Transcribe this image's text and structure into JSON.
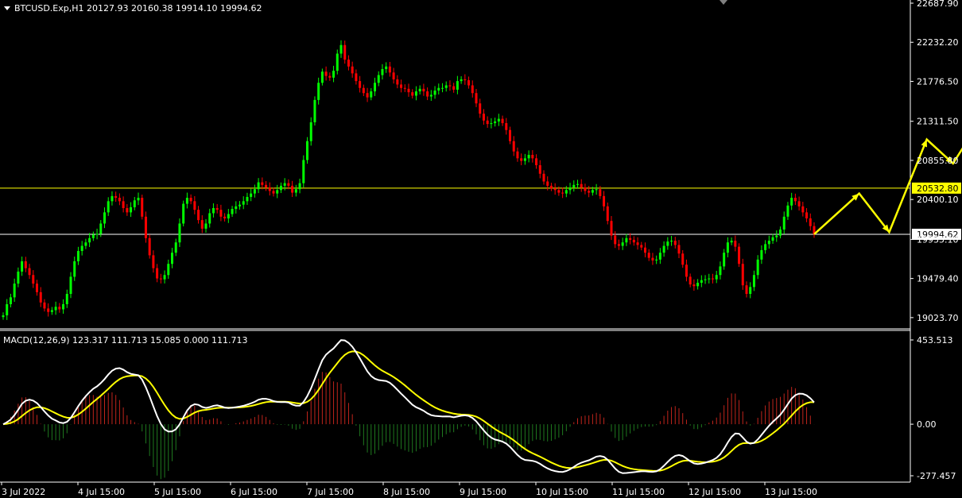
{
  "header": {
    "symbol_info": "BTCUSD.Exp,H1  20127.93 20160.38 19914.10 19994.62"
  },
  "macd_panel": {
    "label": "MACD(12,26,9) 123.317 111.713 15.085 0.000 111.713"
  },
  "colors": {
    "background": "#000000",
    "bull_candle": "#00ff00",
    "bear_candle": "#ff0000",
    "yellow": "#ffff00",
    "white": "#ffffff",
    "histogram_pos": "#c0241c",
    "histogram_neg": "#1f7a1f",
    "grid_frame": "#ffffff"
  },
  "chart_data": [
    {
      "type": "candlestick",
      "title": "BTCUSD.Exp,H1",
      "ylim": [
        18930,
        22687.9
      ],
      "price_ticks": [
        "22687.90",
        "22232.20",
        "21776.50",
        "21311.50",
        "20855.80",
        "20400.10",
        "19935.10",
        "19479.40",
        "19023.70"
      ],
      "x_ticks": [
        "3 Jul 2022",
        "4 Jul 15:00",
        "5 Jul 15:00",
        "6 Jul 15:00",
        "7 Jul 15:00",
        "8 Jul 15:00",
        "9 Jul 15:00",
        "10 Jul 15:00",
        "11 Jul 15:00",
        "12 Jul 15:00",
        "13 Jul 15:00"
      ],
      "horizontal_lines": [
        {
          "value": 20532.8,
          "label": "20532.80",
          "color": "#ffff00"
        },
        {
          "value": 19994.62,
          "label": "19994.62",
          "color": "#ffffff"
        }
      ],
      "closes": [
        19050,
        19180,
        19260,
        19420,
        19560,
        19680,
        19600,
        19520,
        19420,
        19320,
        19200,
        19130,
        19090,
        19110,
        19150,
        19120,
        19180,
        19300,
        19500,
        19680,
        19800,
        19860,
        19900,
        19950,
        19990,
        20000,
        20120,
        20250,
        20380,
        20440,
        20420,
        20380,
        20300,
        20250,
        20310,
        20390,
        20420,
        20200,
        19950,
        19750,
        19600,
        19480,
        19470,
        19520,
        19650,
        19780,
        19900,
        20120,
        20350,
        20420,
        20380,
        20280,
        20160,
        20060,
        20120,
        20240,
        20300,
        20280,
        20200,
        20180,
        20230,
        20290,
        20320,
        20340,
        20380,
        20430,
        20470,
        20520,
        20600,
        20570,
        20540,
        20500,
        20470,
        20510,
        20560,
        20590,
        20560,
        20480,
        20520,
        20590,
        20860,
        21080,
        21300,
        21560,
        21760,
        21890,
        21840,
        21820,
        21900,
        22100,
        22200,
        22030,
        21950,
        21870,
        21780,
        21700,
        21640,
        21590,
        21660,
        21760,
        21850,
        21920,
        21950,
        21880,
        21800,
        21740,
        21700,
        21690,
        21650,
        21610,
        21660,
        21690,
        21660,
        21600,
        21620,
        21670,
        21700,
        21700,
        21730,
        21720,
        21680,
        21780,
        21800,
        21790,
        21730,
        21640,
        21520,
        21400,
        21320,
        21280,
        21290,
        21310,
        21340,
        21290,
        21210,
        21080,
        20960,
        20880,
        20850,
        20880,
        20920,
        20880,
        20800,
        20700,
        20610,
        20560,
        20530,
        20510,
        20480,
        20470,
        20510,
        20540,
        20570,
        20580,
        20540,
        20500,
        20480,
        20510,
        20520,
        20440,
        20320,
        20150,
        19980,
        19880,
        19860,
        19900,
        19950,
        19930,
        19900,
        19870,
        19840,
        19780,
        19720,
        19690,
        19700,
        19780,
        19860,
        19910,
        19920,
        19870,
        19770,
        19640,
        19500,
        19410,
        19390,
        19430,
        19460,
        19470,
        19480,
        19470,
        19520,
        19620,
        19780,
        19900,
        19920,
        19850,
        19650,
        19400,
        19300,
        19380,
        19520,
        19700,
        19810,
        19880,
        19920,
        19960,
        19980,
        20050,
        20200,
        20330,
        20420,
        20380,
        20320,
        20250,
        20180,
        20090,
        19994
      ]
    },
    {
      "type": "macd",
      "title": "MACD(12,26,9)",
      "params": [
        12,
        26,
        9
      ],
      "ylim": [
        -277.457,
        453.513
      ],
      "y_ticks": [
        "453.513",
        "0.00",
        "-277.457"
      ],
      "last_values": {
        "macd": 123.317,
        "signal": 111.713,
        "histogram": 15.085
      }
    }
  ],
  "projection_arrow": {
    "color": "#ffff00",
    "points": [
      [
        0,
        19994.62
      ],
      [
        12,
        20470
      ],
      [
        20,
        20020
      ],
      [
        30,
        21100
      ],
      [
        37,
        20820
      ],
      [
        51,
        21790
      ]
    ]
  }
}
